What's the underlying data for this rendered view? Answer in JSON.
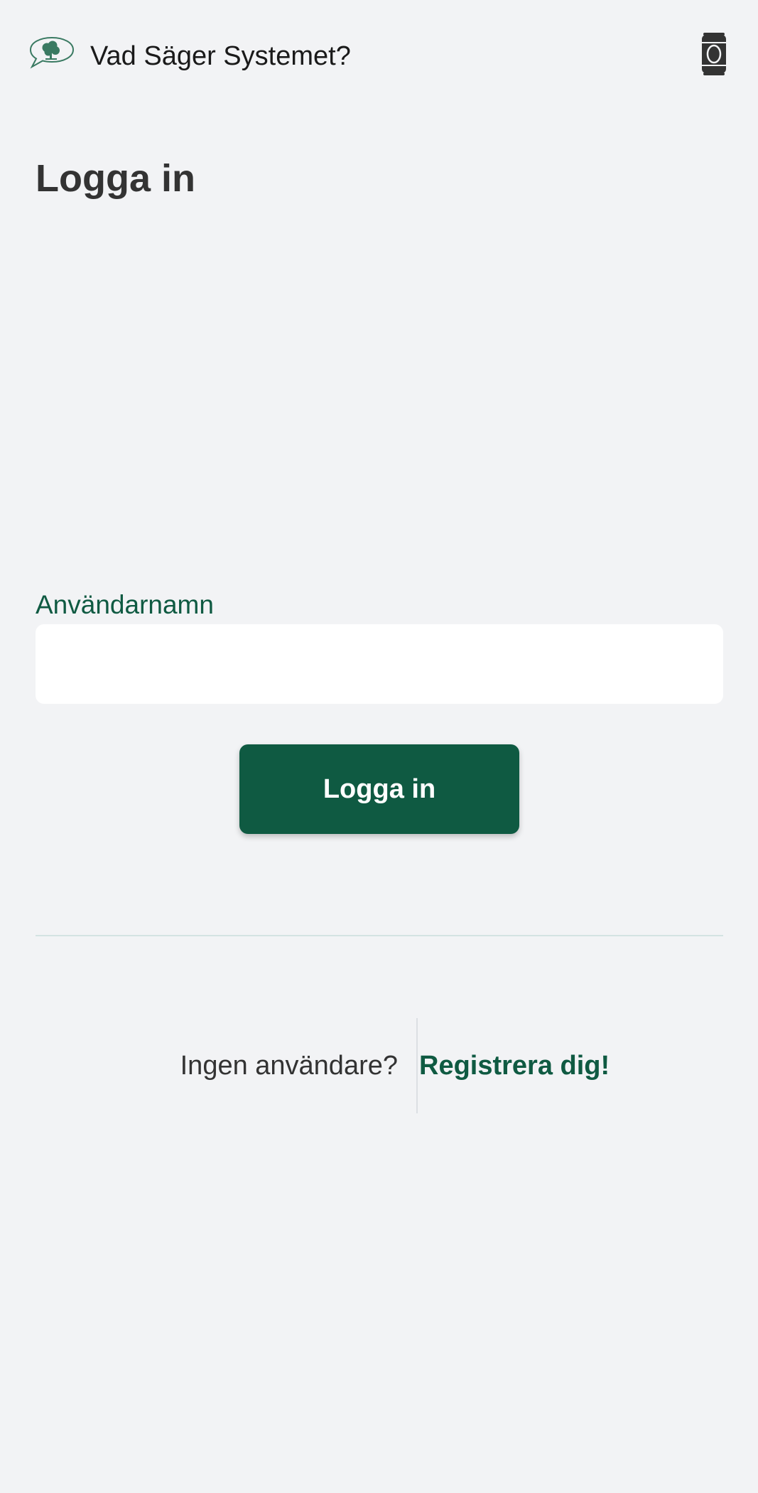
{
  "header": {
    "logo_icon": "speech-bubble-tree-icon",
    "title": "Vad Säger Systemet?",
    "action_icon": "beverage-can-icon"
  },
  "page": {
    "title": "Logga in"
  },
  "form": {
    "username_label": "Användarnamn",
    "username_value": "",
    "submit_label": "Logga in"
  },
  "register": {
    "prompt": "Ingen användare?",
    "link_label": "Registrera dig!"
  },
  "colors": {
    "background": "#f2f3f5",
    "accent": "#0f5a42",
    "text": "#333333",
    "input_background": "#ffffff"
  }
}
